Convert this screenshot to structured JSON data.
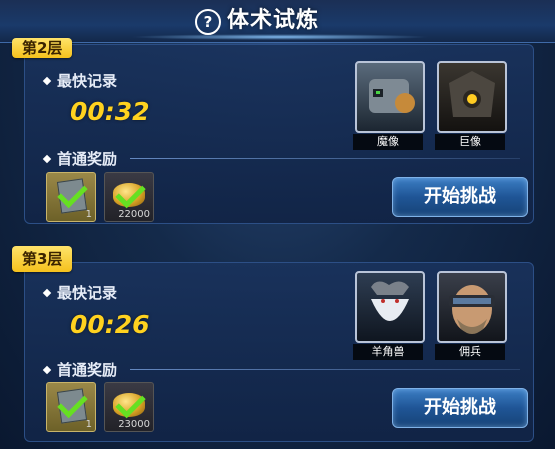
{
  "header": {
    "title": "体术试炼",
    "help_symbol": "?"
  },
  "floors": [
    {
      "tag": "第2层",
      "record_label": "最快记录",
      "time": "00:32",
      "reward_label": "首通奖励",
      "rewards": [
        {
          "type": "manual",
          "icon": "manual-icon",
          "qty": "1",
          "claimed": true
        },
        {
          "type": "gold",
          "icon": "gold-coins-icon",
          "qty": "22000",
          "claimed": true
        }
      ],
      "enemies": [
        {
          "name": "魔像"
        },
        {
          "name": "巨像"
        }
      ],
      "button_label": "开始挑战"
    },
    {
      "tag": "第3层",
      "record_label": "最快记录",
      "time": "00:26",
      "reward_label": "首通奖励",
      "rewards": [
        {
          "type": "manual",
          "icon": "manual-icon",
          "qty": "1",
          "claimed": true
        },
        {
          "type": "gold",
          "icon": "gold-coins-icon",
          "qty": "23000",
          "claimed": true
        }
      ],
      "enemies": [
        {
          "name": "羊角兽"
        },
        {
          "name": "佣兵"
        }
      ],
      "button_label": "开始挑战"
    }
  ],
  "colors": {
    "accent_time": "#ffd21f",
    "tag_bg": "#f5c11c",
    "check": "#66e022",
    "button": "#1f5596"
  }
}
